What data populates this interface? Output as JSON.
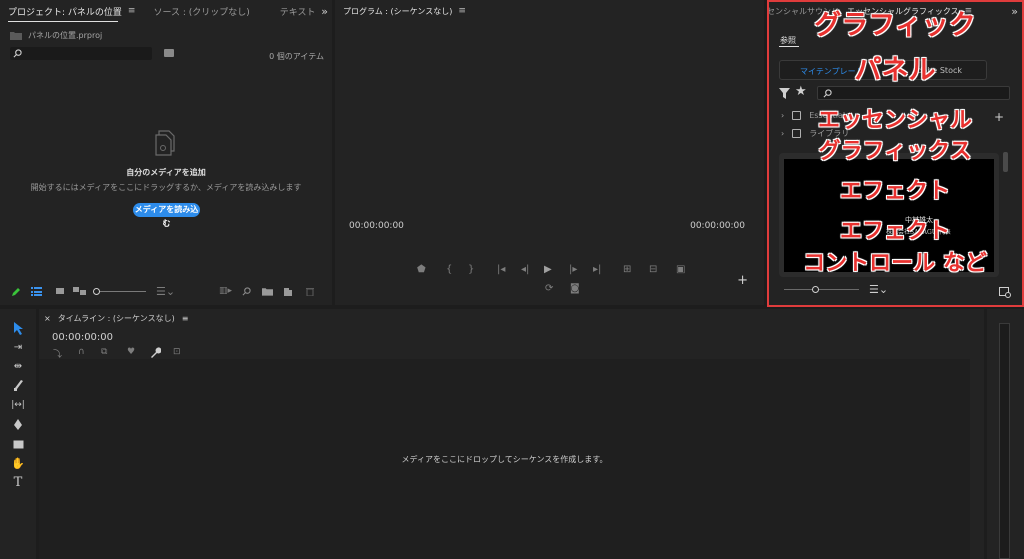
{
  "project_panel": {
    "tabs": [
      {
        "label": "プロジェクト: パネルの位置",
        "active": true
      },
      {
        "label": "ソース : (クリップなし)",
        "active": false
      },
      {
        "label": "テキスト",
        "active": false
      }
    ],
    "overflow": "»",
    "menu_icon": "≡",
    "file_name": "パネルの位置.prproj",
    "item_count": "0 個のアイテム",
    "empty_title": "自分のメディアを追加",
    "empty_desc": "開始するにはメディアをここにドラッグするか、メディアを読み込みします",
    "import_button": "メディアを読み込む"
  },
  "program_panel": {
    "title": "プログラム : (シーケンスなし)",
    "menu_icon": "≡",
    "timecode_left": "00:00:00:00",
    "timecode_right": "00:00:00:00",
    "add": "+"
  },
  "essential_panel": {
    "tabs": [
      {
        "label": "センシャルサウンド",
        "active": false
      },
      {
        "label": "エッセンシャルグラフィックス",
        "active": true
      }
    ],
    "menu_icon": "≡",
    "overflow": "»",
    "sub_tab": "参照",
    "button_my_templates": "マイテンプレート",
    "button_stock": "Adobe Stock",
    "tree_items": [
      "Essential",
      "ライブラリ"
    ],
    "preview_lines": [
      "中村雄太",
      "株式会社SAKAGU 代表"
    ]
  },
  "timeline": {
    "close": "×",
    "title": "タイムライン : (シーケンスなし)",
    "menu_icon": "≡",
    "timecode": "00:00:00:00",
    "drop_message": "メディアをここにドロップしてシーケンスを作成します。"
  },
  "annotation": {
    "line1": "グラフィック",
    "line2": "パネル",
    "line3": "エッセンシャル",
    "line4": "グラフィックス",
    "line5": "エフェクト",
    "line6": "エフェクト",
    "line7": "コントロール など",
    "color": "#e8312f"
  },
  "colors": {
    "accent_blue": "#2d8ceb",
    "highlight_red": "#e03c3c"
  }
}
